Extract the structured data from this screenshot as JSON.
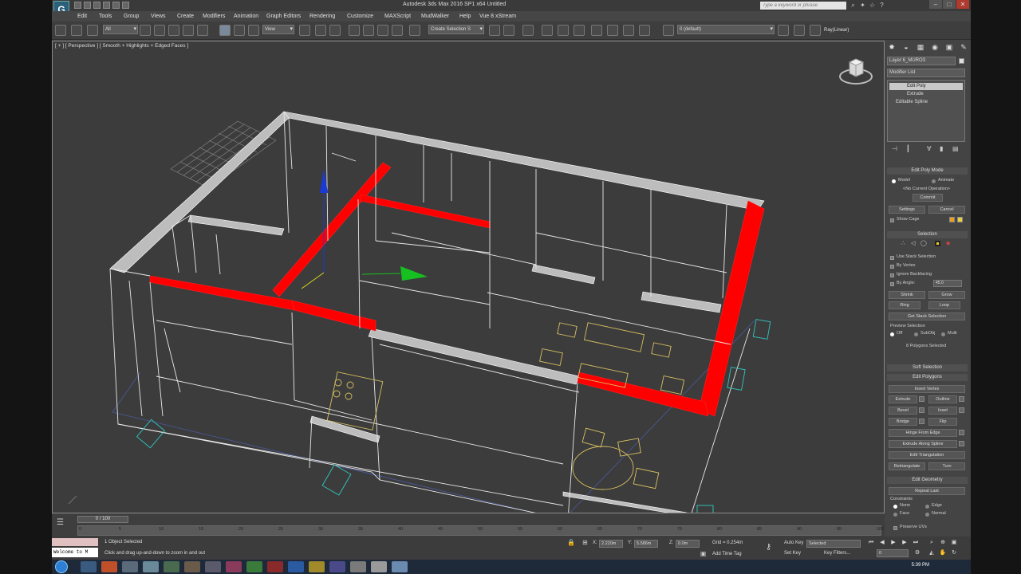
{
  "app": {
    "title": "Autodesk 3ds Max  2016 SP1 x64    Untitled",
    "search_placeholder": "Type a keyword or phrase"
  },
  "menu": [
    "Edit",
    "Tools",
    "Group",
    "Views",
    "Create",
    "Modifiers",
    "Animation",
    "Graph Editors",
    "Rendering",
    "Customize",
    "MAXScript",
    "MudWalker",
    "Help",
    "Vue 8 xStream"
  ],
  "toolbar": {
    "selection_filter": "All",
    "ref_coord": "View",
    "named_selection": "Create Selection S",
    "layer": "0 (default)",
    "workspace": "Ray(Linear)"
  },
  "viewport": {
    "label": "[ + ] [ Perspective ] [ Smooth + Highlights + Edged Faces ]"
  },
  "command_panel": {
    "object_name": "Layer:6_MURO3",
    "modifier_list": "Modifier List",
    "stack": [
      "Edit Poly",
      "Extrude",
      "Editable Spline"
    ],
    "edit_poly_mode": {
      "header": "Edit Poly Mode",
      "model": "Model",
      "animate": "Animate",
      "operation": "<No Current Operation>",
      "commit": "Commit",
      "settings": "Settings",
      "cancel": "Cancel",
      "show_cage": "Show Cage"
    },
    "selection": {
      "header": "Selection",
      "use_stack": "Use Stack Selection",
      "by_vertex": "By Vertex",
      "ignore_backfacing": "Ignore Backfacing",
      "by_angle": "By Angle:",
      "angle_value": "45.0",
      "shrink": "Shrink",
      "grow": "Grow",
      "ring": "Ring",
      "loop": "Loop",
      "get_stack": "Get Stack Selection",
      "preview": "Preview Selection",
      "off": "Off",
      "subobj": "SubObj",
      "multi": "Multi",
      "status": "8 Polygons Selected"
    },
    "soft_selection": "Soft Selection",
    "edit_polygons": {
      "header": "Edit Polygons",
      "insert_vertex": "Insert Vertex",
      "extrude": "Extrude",
      "outline": "Outline",
      "bevel": "Bevel",
      "inset": "Inset",
      "bridge": "Bridge",
      "flip": "Flip",
      "hinge": "Hinge From Edge",
      "extrude_spline": "Extrude Along Spline",
      "edit_tri": "Edit Triangulation",
      "retriangulate": "Retriangulate",
      "turn": "Turn"
    },
    "edit_geometry": {
      "header": "Edit Geometry",
      "repeat_last": "Repeat Last",
      "constraints": "Constraints",
      "none": "None",
      "edge": "Edge",
      "face": "Face",
      "normal": "Normal",
      "preserve_uvs": "Preserve UVs"
    }
  },
  "timeline": {
    "slider": "0 / 100",
    "ticks": [
      "0",
      "5",
      "10",
      "15",
      "20",
      "25",
      "30",
      "35",
      "40",
      "45",
      "50",
      "55",
      "60",
      "65",
      "70",
      "75",
      "80",
      "85",
      "90",
      "95",
      "100"
    ]
  },
  "status": {
    "welcome": "Welcome to M",
    "selected": "1 Object Selected",
    "prompt": "Click and drag up-and-down to zoom in and out",
    "x": "2.220m",
    "y": "5.586m",
    "z": "0.0m",
    "grid": "Grid = 0.254m",
    "add_time_tag": "Add Time Tag",
    "auto_key": "Auto Key",
    "set_key": "Set Key",
    "key_mode": "Selected",
    "key_filters": "Key Filters...",
    "frame": "0"
  },
  "taskbar": {
    "clock": "5:39 PM"
  },
  "colors": {
    "selection_red": "#ff0000",
    "wire": "#ffffff",
    "furniture": "#d8c060",
    "cameras": "#2fc8c0"
  }
}
